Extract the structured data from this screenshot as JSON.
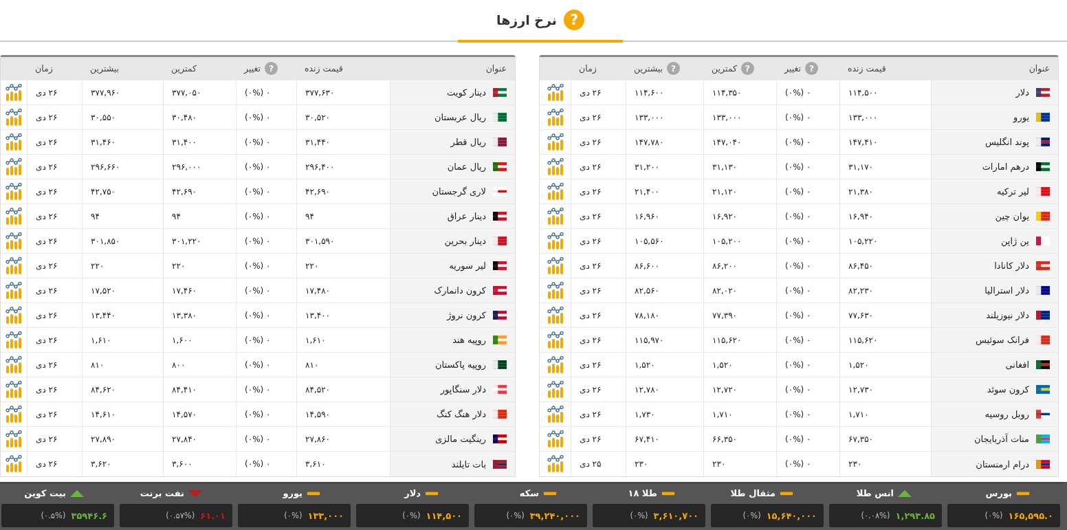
{
  "title": "نرخ ارزها",
  "help_glyph": "?",
  "tables": [
    {
      "columns": [
        {
          "label": "عنوان",
          "help": false
        },
        {
          "label": "قیمت زنده",
          "help": false
        },
        {
          "label": "تغییر",
          "help": true
        },
        {
          "label": "کمترین",
          "help": true
        },
        {
          "label": "بیشترین",
          "help": true
        },
        {
          "label": "زمان",
          "help": false
        }
      ],
      "rows": [
        {
          "name": "دلار",
          "price": "۱۱۴,۵۰۰",
          "change": "۰ (۰%)",
          "low": "۱۱۴,۳۵۰",
          "high": "۱۱۴,۶۰۰",
          "time": "۲۶ دی"
        },
        {
          "name": "یورو",
          "price": "۱۳۳,۰۰۰",
          "change": "۰ (۰%)",
          "low": "۱۳۳,۰۰۰",
          "high": "۱۳۳,۰۰۰",
          "time": "۲۶ دی"
        },
        {
          "name": "پوند انگلیس",
          "price": "۱۴۷,۴۱۰",
          "change": "۰ (۰%)",
          "low": "۱۴۷,۰۴۰",
          "high": "۱۴۷,۷۸۰",
          "time": "۲۶ دی"
        },
        {
          "name": "درهم امارات",
          "price": "۳۱,۱۷۰",
          "change": "۰ (۰%)",
          "low": "۳۱,۱۳۰",
          "high": "۳۱,۲۰۰",
          "time": "۲۶ دی"
        },
        {
          "name": "لیر ترکیه",
          "price": "۲۱,۳۸۰",
          "change": "۰ (۰%)",
          "low": "۲۱,۱۲۰",
          "high": "۲۱,۴۰۰",
          "time": "۲۶ دی"
        },
        {
          "name": "یوان چین",
          "price": "۱۶,۹۴۰",
          "change": "۰ (۰%)",
          "low": "۱۶,۹۲۰",
          "high": "۱۶,۹۶۰",
          "time": "۲۶ دی"
        },
        {
          "name": "ین ژاپن",
          "price": "۱۰۵,۲۲۰",
          "change": "۰ (۰%)",
          "low": "۱۰۵,۲۰۰",
          "high": "۱۰۵,۵۶۰",
          "time": "۲۶ دی"
        },
        {
          "name": "دلار کانادا",
          "price": "۸۶,۴۵۰",
          "change": "۰ (۰%)",
          "low": "۸۶,۲۰۰",
          "high": "۸۶,۶۰۰",
          "time": "۲۶ دی"
        },
        {
          "name": "دلار استرالیا",
          "price": "۸۲,۲۳۰",
          "change": "۰ (۰%)",
          "low": "۸۲,۰۲۰",
          "high": "۸۲,۵۶۰",
          "time": "۲۶ دی"
        },
        {
          "name": "دلار نیوزیلند",
          "price": "۷۷,۶۳۰",
          "change": "۰ (۰%)",
          "low": "۷۷,۳۹۰",
          "high": "۷۸,۱۸۰",
          "time": "۲۶ دی"
        },
        {
          "name": "فرانک سوئیس",
          "price": "۱۱۵,۶۲۰",
          "change": "۰ (۰%)",
          "low": "۱۱۵,۶۲۰",
          "high": "۱۱۵,۹۷۰",
          "time": "۲۶ دی"
        },
        {
          "name": "افغانی",
          "price": "۱,۵۲۰",
          "change": "۰ (۰%)",
          "low": "۱,۵۲۰",
          "high": "۱,۵۲۰",
          "time": "۲۶ دی"
        },
        {
          "name": "کرون سوئد",
          "price": "۱۲,۷۳۰",
          "change": "۰ (۰%)",
          "low": "۱۲,۷۲۰",
          "high": "۱۲,۷۸۰",
          "time": "۲۶ دی"
        },
        {
          "name": "روبل روسیه",
          "price": "۱,۷۱۰",
          "change": "۰ (۰%)",
          "low": "۱,۷۱۰",
          "high": "۱,۷۳۰",
          "time": "۲۶ دی"
        },
        {
          "name": "منات آذربایجان",
          "price": "۶۷,۳۵۰",
          "change": "۰ (۰%)",
          "low": "۶۶,۳۵۰",
          "high": "۶۷,۴۱۰",
          "time": "۲۶ دی"
        },
        {
          "name": "درام ارمنستان",
          "price": "۲۳۰",
          "change": "۰ (۰%)",
          "low": "۲۳۰",
          "high": "۲۳۰",
          "time": "۲۵ دی"
        }
      ]
    },
    {
      "columns": [
        {
          "label": "عنوان",
          "help": false
        },
        {
          "label": "قیمت زنده",
          "help": false
        },
        {
          "label": "تغییر",
          "help": true
        },
        {
          "label": "کمترین",
          "help": false
        },
        {
          "label": "بیشترین",
          "help": false
        },
        {
          "label": "زمان",
          "help": false
        }
      ],
      "rows": [
        {
          "name": "دینار کویت",
          "price": "۳۷۷,۶۳۰",
          "change": "۰ (۰%)",
          "low": "۳۷۷,۰۵۰",
          "high": "۳۷۷,۹۶۰",
          "time": "۲۶ دی"
        },
        {
          "name": "ریال عربستان",
          "price": "۳۰,۵۲۰",
          "change": "۰ (۰%)",
          "low": "۳۰,۴۸۰",
          "high": "۳۰,۵۵۰",
          "time": "۲۶ دی"
        },
        {
          "name": "ریال قطر",
          "price": "۳۱,۴۴۰",
          "change": "۰ (۰%)",
          "low": "۳۱,۴۰۰",
          "high": "۳۱,۴۶۰",
          "time": "۲۶ دی"
        },
        {
          "name": "ریال عمان",
          "price": "۲۹۶,۴۰۰",
          "change": "۰ (۰%)",
          "low": "۲۹۶,۰۰۰",
          "high": "۲۹۶,۶۶۰",
          "time": "۲۶ دی"
        },
        {
          "name": "لاری گرجستان",
          "price": "۴۲,۶۹۰",
          "change": "۰ (۰%)",
          "low": "۴۲,۶۹۰",
          "high": "۴۲,۷۵۰",
          "time": "۲۶ دی"
        },
        {
          "name": "دینار عراق",
          "price": "۹۴",
          "change": "۰ (۰%)",
          "low": "۹۴",
          "high": "۹۴",
          "time": "۲۶ دی"
        },
        {
          "name": "دینار بحرین",
          "price": "۳۰۱,۵۹۰",
          "change": "۰ (۰%)",
          "low": "۳۰۱,۲۲۰",
          "high": "۳۰۱,۸۵۰",
          "time": "۲۶ دی"
        },
        {
          "name": "لیر سوریه",
          "price": "۲۲۰",
          "change": "۰ (۰%)",
          "low": "۲۲۰",
          "high": "۲۲۰",
          "time": "۲۶ دی"
        },
        {
          "name": "کرون دانمارک",
          "price": "۱۷,۴۸۰",
          "change": "۰ (۰%)",
          "low": "۱۷,۴۶۰",
          "high": "۱۷,۵۲۰",
          "time": "۲۶ دی"
        },
        {
          "name": "کرون نروژ",
          "price": "۱۳,۴۰۰",
          "change": "۰ (۰%)",
          "low": "۱۳,۳۸۰",
          "high": "۱۳,۴۴۰",
          "time": "۲۶ دی"
        },
        {
          "name": "روپیه هند",
          "price": "۱,۶۱۰",
          "change": "۰ (۰%)",
          "low": "۱,۶۰۰",
          "high": "۱,۶۱۰",
          "time": "۲۶ دی"
        },
        {
          "name": "روپیه پاکستان",
          "price": "۸۱۰",
          "change": "۰ (۰%)",
          "low": "۸۰۰",
          "high": "۸۱۰",
          "time": "۲۶ دی"
        },
        {
          "name": "دلار سنگاپور",
          "price": "۸۴,۵۲۰",
          "change": "۰ (۰%)",
          "low": "۸۴,۴۱۰",
          "high": "۸۴,۶۲۰",
          "time": "۲۶ دی"
        },
        {
          "name": "دلار هنگ کنگ",
          "price": "۱۴,۵۹۰",
          "change": "۰ (۰%)",
          "low": "۱۴,۵۷۰",
          "high": "۱۴,۶۱۰",
          "time": "۲۶ دی"
        },
        {
          "name": "رینگیت مالزی",
          "price": "۲۷,۸۶۰",
          "change": "۰ (۰%)",
          "low": "۲۷,۸۴۰",
          "high": "۲۷,۸۹۰",
          "time": "۲۶ دی"
        },
        {
          "name": "بات تایلند",
          "price": "۳,۶۱۰",
          "change": "۰ (۰%)",
          "low": "۳,۶۰۰",
          "high": "۳,۶۲۰",
          "time": "۲۶ دی"
        }
      ]
    }
  ],
  "ticker": [
    {
      "label": "بورس",
      "kind": "flat",
      "value": "۱۶۵,۵۹۵.۰",
      "change": "(۰%)"
    },
    {
      "label": "انس طلا",
      "kind": "up",
      "value": "۱,۲۹۳.۸۵",
      "change": "(۰.۰۸%)"
    },
    {
      "label": "مثقال طلا",
      "kind": "flat",
      "value": "۱۵,۶۴۰,۰۰۰",
      "change": "(۰%)"
    },
    {
      "label": "طلا ۱۸",
      "kind": "flat",
      "value": "۳,۶۱۰,۷۰۰",
      "change": "(۰%)"
    },
    {
      "label": "سکه",
      "kind": "flat",
      "value": "۳۹,۲۴۰,۰۰۰",
      "change": "(۰%)"
    },
    {
      "label": "دلار",
      "kind": "flat",
      "value": "۱۱۴,۵۰۰",
      "change": "(۰%)"
    },
    {
      "label": "یورو",
      "kind": "flat",
      "value": "۱۳۳,۰۰۰",
      "change": "(۰%)"
    },
    {
      "label": "نفت برنت",
      "kind": "down",
      "value": "۶۱.۰۱",
      "change": "(۰.۵۷%)"
    },
    {
      "label": "بیت کوین",
      "kind": "up",
      "value": "۳۵۹۴۶.۶",
      "change": "(۰.۵%)"
    }
  ]
}
